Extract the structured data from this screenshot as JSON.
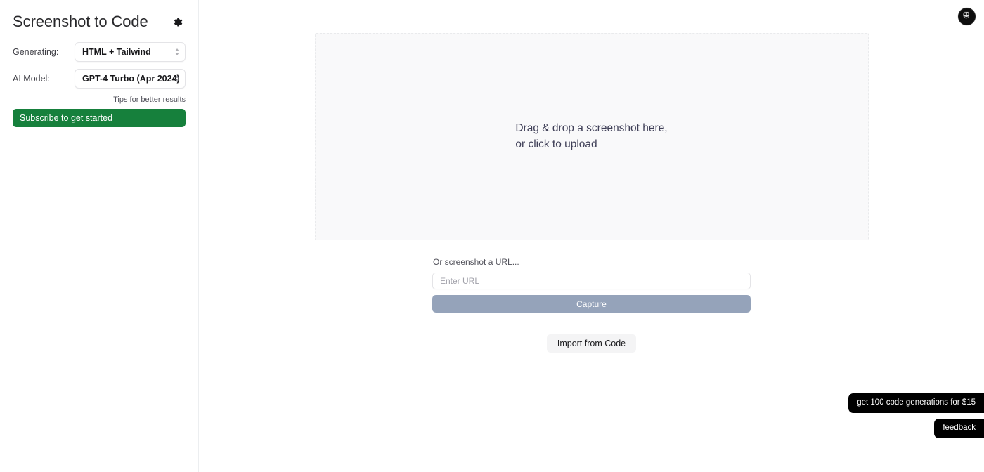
{
  "sidebar": {
    "title": "Screenshot to Code",
    "settings_icon": "gear-icon",
    "fields": {
      "generating": {
        "label": "Generating:",
        "value": "HTML + Tailwind"
      },
      "ai_model": {
        "label": "AI Model:",
        "value": "GPT-4 Turbo (Apr 2024)"
      }
    },
    "tips_link": "Tips for better results",
    "subscribe_button": "Subscribe to get started"
  },
  "main": {
    "avatar_icon": "user-avatar-icon",
    "dropzone": {
      "line1": "Drag & drop a screenshot here,",
      "line2": "or click to upload"
    },
    "url_section": {
      "label": "Or screenshot a URL...",
      "input_value": "",
      "input_placeholder": "Enter URL",
      "capture_button": "Capture"
    },
    "import_button": "Import from Code"
  },
  "badges": {
    "promo": "get 100 code generations for $15",
    "feedback": "feedback"
  },
  "colors": {
    "subscribe_green": "#16803c",
    "capture_slate": "#95a3ba",
    "badge_black": "#000000",
    "dropzone_bg": "#f9f9fa",
    "border_gray": "#e4e4e7"
  }
}
